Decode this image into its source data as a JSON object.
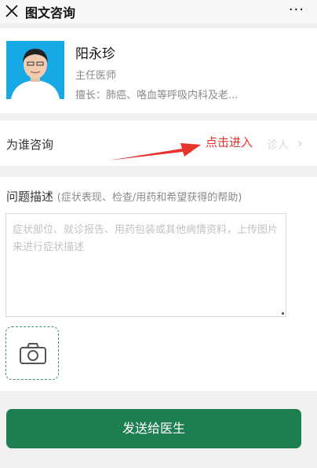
{
  "header": {
    "title": "图文咨询",
    "more_label": "···"
  },
  "doctor": {
    "name": "阳永珍",
    "title": "主任医师",
    "specialty": "擅长：肺癌、咯血等呼吸内科及老..."
  },
  "consult_for": {
    "label": "为谁咨询",
    "value": "诊人"
  },
  "problem": {
    "title": "问题描述",
    "hint": "(症状表现、检查/用药和希望获得的帮助)",
    "placeholder": "症状部位、就诊报告、用药包装或其他病情资料，上传图片来进行症状描述"
  },
  "send_button_label": "发送给医生",
  "annotation": {
    "text": "点击进入",
    "color": "#e8322c"
  },
  "colors": {
    "accent": "#1f7e4f",
    "avatar_bg": "#17a9e6"
  },
  "icons": {
    "close": "close-icon",
    "more": "more-icon",
    "camera": "camera-icon",
    "chevron": "chevron-right-icon"
  }
}
